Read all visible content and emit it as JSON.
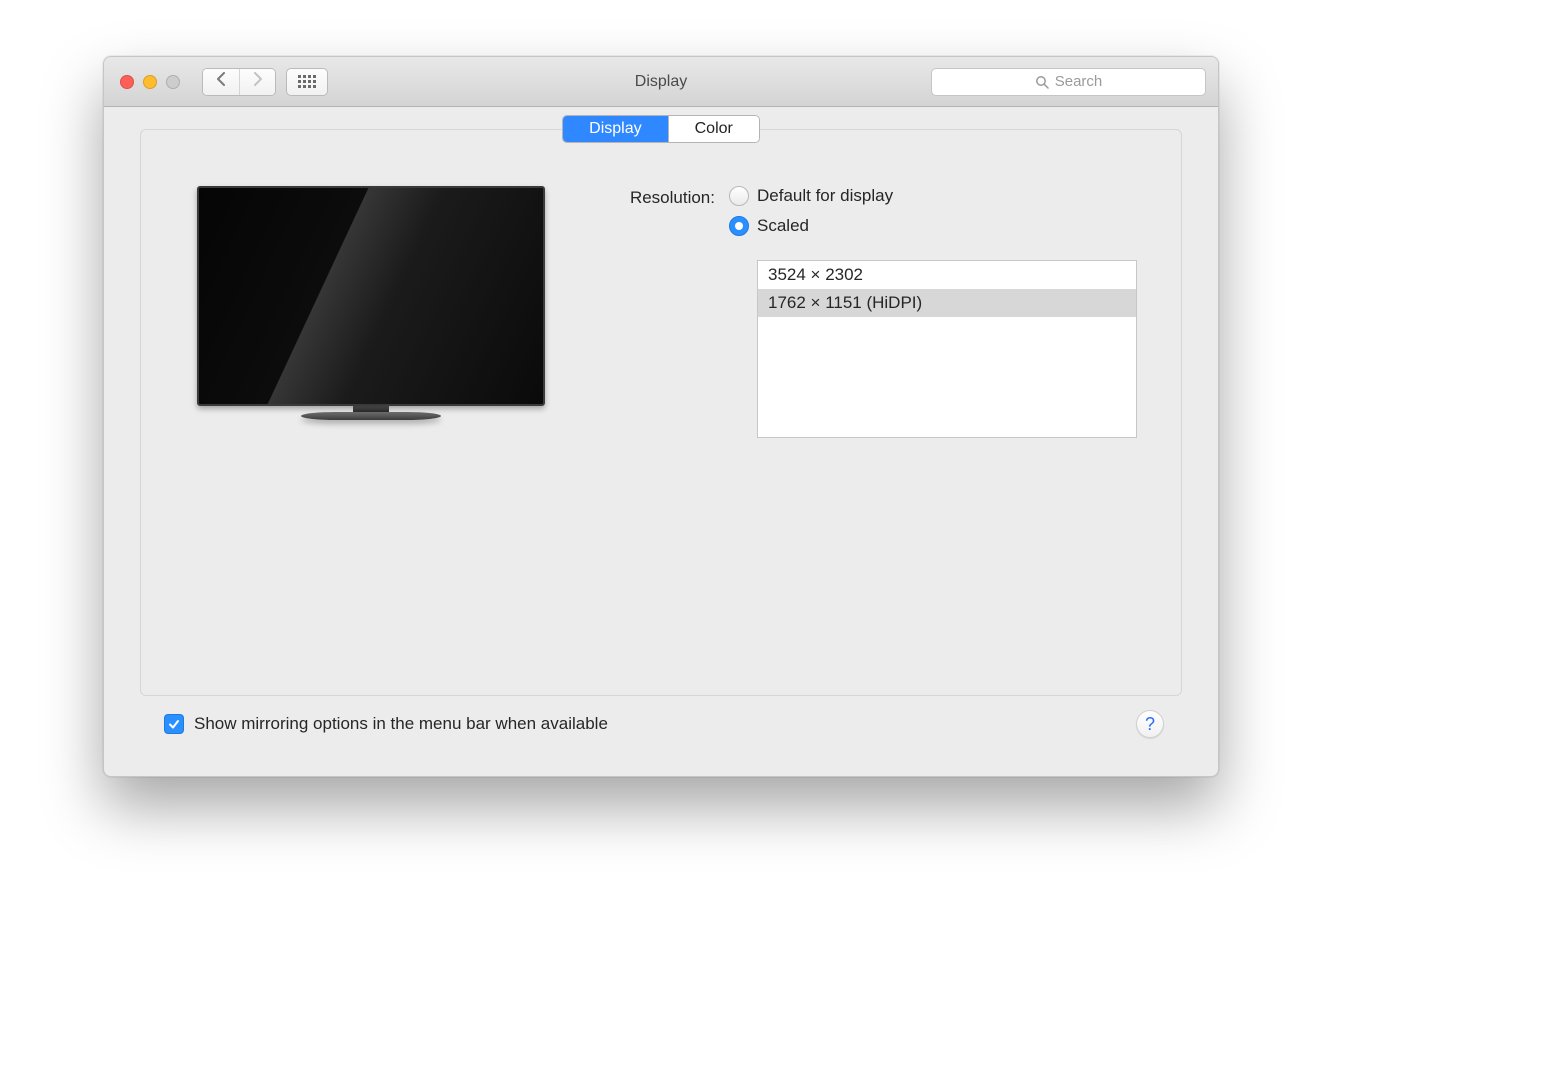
{
  "window": {
    "title": "Display"
  },
  "toolbar": {
    "search_placeholder": "Search"
  },
  "tabs": {
    "display": "Display",
    "color": "Color",
    "active": "display"
  },
  "form": {
    "resolution_label": "Resolution:",
    "radio_default": "Default for display",
    "radio_scaled": "Scaled",
    "selected_radio": "scaled"
  },
  "resolutions": {
    "items": [
      {
        "label": "3524 × 2302"
      },
      {
        "label": "1762 × 1151 (HiDPI)"
      }
    ],
    "selected_index": 1
  },
  "footer": {
    "mirror_checkbox_label": "Show mirroring options in the menu bar when available",
    "mirror_checked": true,
    "help": "?"
  }
}
